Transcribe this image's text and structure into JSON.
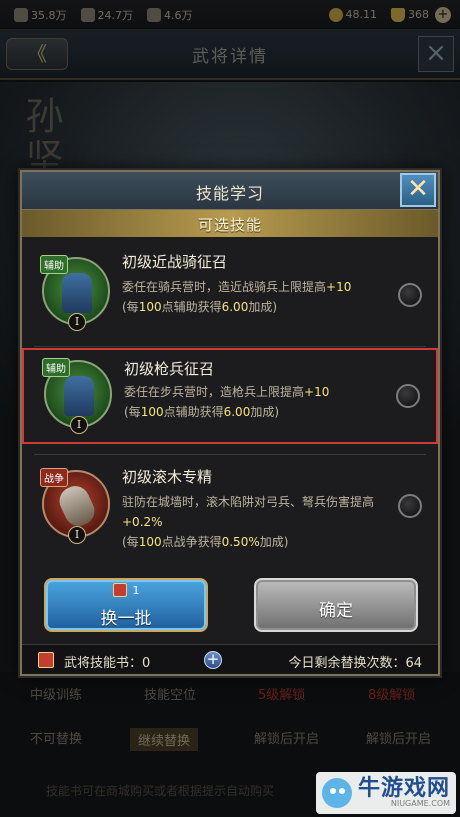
{
  "topbar": {
    "res1": "35.8万",
    "res2": "24.7万",
    "res3": "4.6万",
    "gold": "48.11",
    "ingot": "368",
    "plus": "+"
  },
  "header": {
    "back_label": "《",
    "title": "武将详情",
    "close_label": "×"
  },
  "hero_name": "孙坚",
  "background": {
    "row1": [
      "中级训练",
      "技能空位",
      "5级解锁",
      "8级解锁"
    ],
    "row2": [
      "不可替换",
      "继续替换",
      "解锁后开启",
      "解锁后开启"
    ],
    "tip": "技能书可在商城购买或者根据提示自动购买"
  },
  "modal": {
    "title": "技能学习",
    "close_label": "✕",
    "section_title": "可选技能",
    "skills": [
      {
        "tag": "辅助",
        "level": "I",
        "name": "初级近战骑征召",
        "desc_main": "委任在骑兵营时，造近战骑兵上限提高",
        "desc_hl": "+10",
        "desc_rate_pre": "(每",
        "desc_rate_hl1": "100",
        "desc_rate_mid": "点辅助获得",
        "desc_rate_hl2": "6.00",
        "desc_rate_post": "加成)"
      },
      {
        "tag": "辅助",
        "level": "I",
        "name": "初级枪兵征召",
        "desc_main": "委任在步兵营时，造枪兵上限提高",
        "desc_hl": "+10",
        "desc_rate_pre": "(每",
        "desc_rate_hl1": "100",
        "desc_rate_mid": "点辅助获得",
        "desc_rate_hl2": "6.00",
        "desc_rate_post": "加成)"
      },
      {
        "tag": "战争",
        "level": "I",
        "name": "初级滚木专精",
        "desc_main": "驻防在城墙时，滚木陷阱对弓兵、弩兵伤害提高",
        "desc_hl": "+0.2%",
        "desc_rate_pre": "(每",
        "desc_rate_hl1": "100",
        "desc_rate_mid": "点战争获得",
        "desc_rate_hl2": "0.50%",
        "desc_rate_post": "加成)"
      }
    ],
    "swap_button": {
      "cost": "1",
      "label": "换一批"
    },
    "confirm_button": {
      "label": "确定"
    },
    "footer": {
      "books_label": "武将技能书：",
      "books_count": "0",
      "plus": "+",
      "remain_label": "今日剩余替换次数：",
      "remain_count": "64"
    }
  },
  "watermark": {
    "main": "牛游戏网",
    "url": "NIUGAME.COM"
  }
}
